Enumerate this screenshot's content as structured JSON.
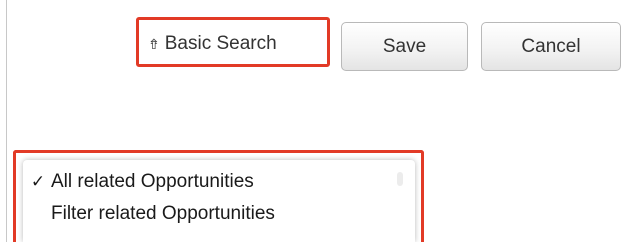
{
  "toolbar": {
    "basic_search_label": "Basic Search",
    "basic_search_icon": "double-chevron-up-icon",
    "save_label": "Save",
    "cancel_label": "Cancel"
  },
  "filter_dropdown": {
    "items": [
      {
        "label": "All related Opportunities",
        "selected": true,
        "check": "✓"
      },
      {
        "label": "Filter related Opportunities",
        "selected": false,
        "check": "✓"
      }
    ]
  },
  "colors": {
    "highlight": "#e23a26",
    "button_border": "#b9b9b9",
    "text": "#333333"
  }
}
